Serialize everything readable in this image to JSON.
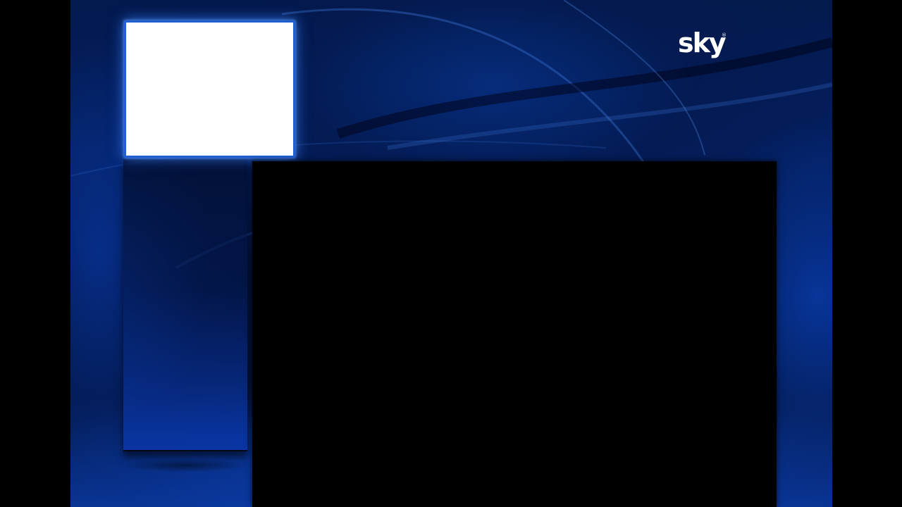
{
  "brand": {
    "logo_text": "sky",
    "trademark": "®",
    "accent_color": "#1f5fd0",
    "background_color": "#041f5c"
  },
  "thumbnail": {
    "state": "focused",
    "content": "blank"
  },
  "video": {
    "content": "blank"
  }
}
